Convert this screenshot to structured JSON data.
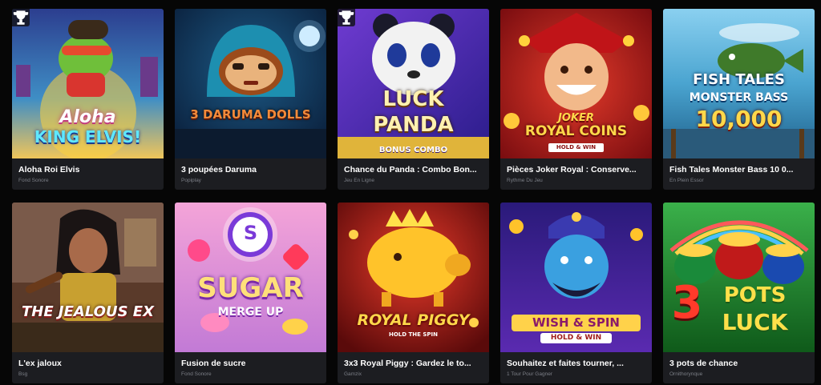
{
  "games": [
    {
      "title": "Aloha Roi Elvis",
      "provider": "Fond Sonore",
      "logo_line1": "Aloha",
      "logo_line2": "KING ELVIS!",
      "trophy": true
    },
    {
      "title": "3 poupées Daruma",
      "provider": "Popiplay",
      "logo_line1": "3 DARUMA DOLLS",
      "trophy": false
    },
    {
      "title": "Chance du Panda : Combo Bon...",
      "provider": "Jeu En Ligne",
      "logo_line1": "LUCK",
      "logo_line2": "PANDA",
      "logo_line3": "BONUS COMBO",
      "trophy": true
    },
    {
      "title": "Pièces Joker Royal : Conserve...",
      "provider": "Rythme Du Jeu",
      "logo_line1": "JOKER",
      "logo_line2": "ROYAL COINS",
      "logo_line3": "HOLD & WIN",
      "trophy": false
    },
    {
      "title": "Fish Tales Monster Bass 10 0...",
      "provider": "En Plein Essor",
      "logo_line1": "FISH TALES",
      "logo_line2": "MONSTER BASS",
      "logo_line3": "10,000",
      "trophy": false
    },
    {
      "title": "L'ex jaloux",
      "provider": "Bsg",
      "logo_line1": "THE JEALOUS EX",
      "trophy": false
    },
    {
      "title": "Fusion de sucre",
      "provider": "Fond Sonore",
      "logo_line1": "SUGAR",
      "logo_line2": "MERGE UP",
      "trophy": false
    },
    {
      "title": "3x3 Royal Piggy : Gardez le to...",
      "provider": "Gamzix",
      "logo_line1": "ROYAL PIGGY",
      "logo_line2": "HOLD THE SPIN",
      "trophy": false
    },
    {
      "title": "Souhaitez et faites tourner, ...",
      "provider": "1 Tour Pour Gagner",
      "logo_line1": "WISH & SPIN",
      "logo_line2": "HOLD & WIN",
      "trophy": false
    },
    {
      "title": "3 pots de chance",
      "provider": "Ornithorynque",
      "logo_line1": "3",
      "logo_line2": "POTS",
      "logo_line3": "LUCK",
      "trophy": false
    }
  ],
  "colors": {
    "page_bg": "#060606",
    "card_bg": "#1c1d21",
    "title": "#ffffff",
    "provider": "#7c7f87"
  },
  "icons": {
    "trophy": "trophy-icon"
  }
}
